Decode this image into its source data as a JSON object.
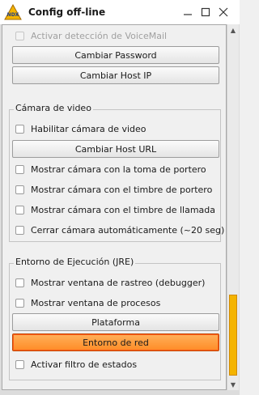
{
  "window": {
    "title": "Config off-line",
    "controls": [
      "minimize-icon",
      "maximize-icon",
      "close-icon"
    ]
  },
  "top": {
    "voicemail": "Activar detección de VoiceMail",
    "change_password": "Cambiar Password",
    "change_host_ip": "Cambiar Host IP"
  },
  "camera": {
    "title": "Cámara de video",
    "enable": "Habilitar cámara de video",
    "change_host_url": "Cambiar Host URL",
    "show_porter_touch": "Mostrar cámara con la toma de portero",
    "show_porter_bell": "Mostrar cámara con el timbre de portero",
    "show_call_bell": "Mostrar cámara con el timbre de llamada",
    "auto_close": "Cerrar cámara automáticamente (~20 seg)"
  },
  "runtime": {
    "title": "Entorno de Ejecución (JRE)",
    "show_trace": "Mostrar ventana de rastreo (debugger)",
    "show_processes": "Mostrar ventana de procesos",
    "platform": "Plataforma",
    "network_env": "Entorno de red",
    "state_filter": "Activar filtro de estados"
  },
  "colors": {
    "active_button": "#ff8c26",
    "scroll_thumb": "#f4b400"
  }
}
